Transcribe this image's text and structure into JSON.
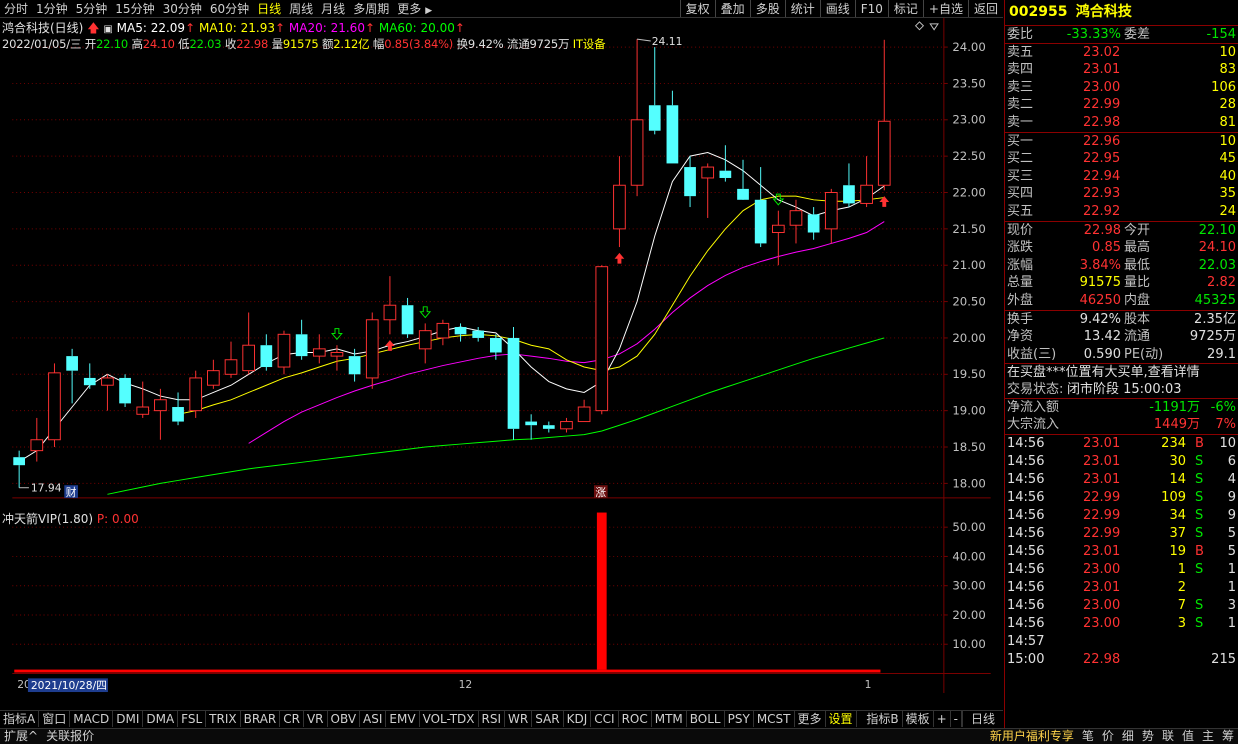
{
  "toolbar": {
    "periods": [
      "分时",
      "1分钟",
      "5分钟",
      "15分钟",
      "30分钟",
      "60分钟",
      "日线",
      "周线",
      "月线",
      "多周期",
      "更多"
    ],
    "active_period": "日线",
    "more_arrow": "▶",
    "right_buttons": [
      "复权",
      "叠加",
      "多股",
      "统计",
      "画线",
      "F10",
      "标记",
      "+自选",
      "返回"
    ]
  },
  "info": {
    "name_label": "鸿合科技(日线)",
    "ma5_label": "MA5: 22.09",
    "ma10_label": "MA10: 21.93",
    "ma20_label": "MA20: 21.60",
    "ma60_label": "MA60: 20.00",
    "date": "2022/01/05/三",
    "open_label": "开",
    "open": "22.10",
    "high_label": "高",
    "high": "24.10",
    "low_label": "低",
    "low": "22.03",
    "close_label": "收",
    "close": "22.98",
    "volume_label": "量",
    "volume": "91575",
    "amount_label": "额",
    "amount": "2.12亿",
    "change_label": "幅",
    "change": "0.85(3.84%)",
    "turnover_label": "换",
    "turnover": "9.42%",
    "float_label": "流通",
    "float": "9725万",
    "sector": "IT设备"
  },
  "colors": {
    "up": "#ff3232",
    "down": "#54ffff",
    "ma5": "#ffffff",
    "ma10": "#ffff00",
    "ma20": "#ff00ff",
    "ma60": "#00ff00",
    "grid": "#7a0000",
    "axis_text": "#c0c0c0"
  },
  "chart_data": {
    "type": "candlestick",
    "y_axis_labels": [
      "24.00",
      "23.50",
      "23.00",
      "22.50",
      "22.00",
      "21.50",
      "21.00",
      "20.50",
      "20.00",
      "19.50",
      "19.00",
      "18.50",
      "18.00"
    ],
    "ylim": [
      17.8,
      24.4
    ],
    "max_annotation": "24.11",
    "min_annotation": "17.94",
    "candles": [
      {
        "o": 18.36,
        "h": 18.45,
        "l": 17.94,
        "c": 18.25
      },
      {
        "o": 18.45,
        "h": 18.9,
        "l": 18.3,
        "c": 18.6
      },
      {
        "o": 18.6,
        "h": 19.65,
        "l": 18.5,
        "c": 19.52
      },
      {
        "o": 19.75,
        "h": 19.85,
        "l": 19.1,
        "c": 19.55
      },
      {
        "o": 19.45,
        "h": 19.65,
        "l": 19.3,
        "c": 19.35
      },
      {
        "o": 19.35,
        "h": 19.5,
        "l": 19.0,
        "c": 19.45
      },
      {
        "o": 19.45,
        "h": 19.5,
        "l": 19.05,
        "c": 19.1
      },
      {
        "o": 18.95,
        "h": 19.4,
        "l": 18.9,
        "c": 19.05
      },
      {
        "o": 19.0,
        "h": 19.3,
        "l": 18.6,
        "c": 19.15
      },
      {
        "o": 19.05,
        "h": 19.25,
        "l": 18.8,
        "c": 18.85
      },
      {
        "o": 19.0,
        "h": 19.55,
        "l": 18.9,
        "c": 19.45
      },
      {
        "o": 19.35,
        "h": 19.7,
        "l": 19.3,
        "c": 19.55
      },
      {
        "o": 19.5,
        "h": 19.95,
        "l": 19.45,
        "c": 19.7
      },
      {
        "o": 19.55,
        "h": 20.35,
        "l": 19.5,
        "c": 19.9
      },
      {
        "o": 19.9,
        "h": 20.05,
        "l": 19.55,
        "c": 19.6
      },
      {
        "o": 19.6,
        "h": 20.1,
        "l": 19.5,
        "c": 20.05
      },
      {
        "o": 20.05,
        "h": 20.25,
        "l": 19.7,
        "c": 19.75
      },
      {
        "o": 19.75,
        "h": 20.05,
        "l": 19.65,
        "c": 19.85
      },
      {
        "o": 19.75,
        "h": 19.9,
        "l": 19.55,
        "c": 19.8
      },
      {
        "o": 19.75,
        "h": 19.85,
        "l": 19.4,
        "c": 19.5
      },
      {
        "o": 19.45,
        "h": 20.35,
        "l": 19.3,
        "c": 20.25
      },
      {
        "o": 20.25,
        "h": 20.85,
        "l": 20.05,
        "c": 20.45
      },
      {
        "o": 20.45,
        "h": 20.55,
        "l": 20.0,
        "c": 20.05
      },
      {
        "o": 19.85,
        "h": 20.2,
        "l": 19.65,
        "c": 20.1
      },
      {
        "o": 20.0,
        "h": 20.25,
        "l": 19.9,
        "c": 20.2
      },
      {
        "o": 20.15,
        "h": 20.2,
        "l": 19.95,
        "c": 20.05
      },
      {
        "o": 20.1,
        "h": 20.15,
        "l": 19.95,
        "c": 20.0
      },
      {
        "o": 20.0,
        "h": 20.05,
        "l": 19.7,
        "c": 19.8
      },
      {
        "o": 20.0,
        "h": 20.15,
        "l": 18.6,
        "c": 18.75
      },
      {
        "o": 18.85,
        "h": 18.95,
        "l": 18.6,
        "c": 18.8
      },
      {
        "o": 18.8,
        "h": 18.85,
        "l": 18.7,
        "c": 18.75
      },
      {
        "o": 18.75,
        "h": 18.9,
        "l": 18.7,
        "c": 18.85
      },
      {
        "o": 18.85,
        "h": 19.15,
        "l": 18.85,
        "c": 19.05
      },
      {
        "o": 19.0,
        "h": 21.0,
        "l": 18.95,
        "c": 20.98
      },
      {
        "o": 21.5,
        "h": 22.5,
        "l": 21.25,
        "c": 22.1
      },
      {
        "o": 22.1,
        "h": 24.11,
        "l": 21.95,
        "c": 23.0
      },
      {
        "o": 23.2,
        "h": 24.0,
        "l": 22.8,
        "c": 22.85
      },
      {
        "o": 23.2,
        "h": 23.4,
        "l": 22.4,
        "c": 22.4
      },
      {
        "o": 22.35,
        "h": 22.5,
        "l": 21.8,
        "c": 21.95
      },
      {
        "o": 22.2,
        "h": 22.4,
        "l": 21.65,
        "c": 22.35
      },
      {
        "o": 22.3,
        "h": 22.65,
        "l": 22.15,
        "c": 22.2
      },
      {
        "o": 22.05,
        "h": 22.45,
        "l": 21.95,
        "c": 21.9
      },
      {
        "o": 21.9,
        "h": 22.35,
        "l": 21.25,
        "c": 21.3
      },
      {
        "o": 21.45,
        "h": 21.75,
        "l": 21.0,
        "c": 21.55
      },
      {
        "o": 21.55,
        "h": 21.9,
        "l": 21.3,
        "c": 21.75
      },
      {
        "o": 21.7,
        "h": 21.8,
        "l": 21.35,
        "c": 21.45
      },
      {
        "o": 21.5,
        "h": 22.05,
        "l": 21.3,
        "c": 22.0
      },
      {
        "o": 22.1,
        "h": 22.4,
        "l": 21.8,
        "c": 21.85
      },
      {
        "o": 21.85,
        "h": 22.5,
        "l": 21.8,
        "c": 22.1
      },
      {
        "o": 22.1,
        "h": 24.1,
        "l": 22.03,
        "c": 22.98
      }
    ],
    "ma5": [
      18.3,
      18.45,
      18.75,
      19.05,
      19.35,
      19.5,
      19.38,
      19.3,
      19.2,
      19.15,
      19.15,
      19.25,
      19.35,
      19.5,
      19.65,
      19.77,
      19.8,
      19.8,
      19.85,
      19.78,
      19.82,
      19.9,
      19.95,
      20.02,
      20.1,
      20.15,
      20.1,
      20.07,
      19.85,
      19.6,
      19.4,
      19.3,
      19.25,
      19.4,
      19.85,
      20.5,
      21.4,
      22.15,
      22.5,
      22.55,
      22.45,
      22.3,
      22.1,
      21.9,
      21.8,
      21.68,
      21.75,
      21.8,
      21.92,
      22.09
    ],
    "ma10": [
      null,
      null,
      null,
      null,
      null,
      null,
      null,
      null,
      null,
      18.95,
      19.0,
      19.08,
      19.15,
      19.25,
      19.35,
      19.45,
      19.52,
      19.6,
      19.68,
      19.72,
      19.78,
      19.84,
      19.9,
      19.95,
      20.0,
      20.03,
      20.05,
      20.03,
      19.98,
      19.9,
      19.85,
      19.7,
      19.6,
      19.55,
      19.6,
      19.75,
      20.05,
      20.45,
      20.85,
      21.2,
      21.5,
      21.75,
      21.9,
      21.95,
      21.95,
      21.9,
      21.88,
      21.88,
      21.9,
      21.93
    ],
    "ma20": [
      null,
      null,
      null,
      null,
      null,
      null,
      null,
      null,
      null,
      null,
      null,
      null,
      null,
      18.55,
      18.7,
      18.85,
      18.98,
      19.08,
      19.18,
      19.27,
      19.35,
      19.42,
      19.5,
      19.56,
      19.62,
      19.67,
      19.72,
      19.76,
      19.78,
      19.75,
      19.72,
      19.68,
      19.66,
      19.7,
      19.78,
      19.92,
      20.12,
      20.35,
      20.55,
      20.72,
      20.86,
      20.97,
      21.05,
      21.12,
      21.18,
      21.23,
      21.3,
      21.37,
      21.45,
      21.6
    ],
    "ma60": [
      null,
      null,
      null,
      null,
      null,
      17.85,
      17.9,
      17.95,
      18.0,
      18.04,
      18.08,
      18.12,
      18.16,
      18.2,
      18.23,
      18.26,
      18.29,
      18.32,
      18.35,
      18.38,
      18.41,
      18.44,
      18.47,
      18.5,
      18.52,
      18.54,
      18.56,
      18.58,
      18.6,
      18.61,
      18.63,
      18.65,
      18.67,
      18.72,
      18.8,
      18.88,
      18.97,
      19.06,
      19.15,
      19.24,
      19.32,
      19.4,
      19.48,
      19.56,
      19.64,
      19.72,
      19.79,
      19.86,
      19.93,
      20.0
    ],
    "arrows_up_at": [
      21,
      34,
      49
    ],
    "arrows_down_at": [
      18,
      23,
      43
    ],
    "markers": [
      {
        "at": 3,
        "text": "财"
      },
      {
        "at": 33,
        "text": "涨"
      }
    ],
    "indicator": {
      "name": "冲天箭VIP(1.80)",
      "p_label": "P: 0.00",
      "y_axis_labels": [
        "50.00",
        "40.00",
        "30.00",
        "20.00",
        "10.00"
      ],
      "ylim": [
        0,
        58
      ],
      "spike_at": 33,
      "spike_value": 55
    },
    "x_labels": [
      {
        "at": 0,
        "text": "20"
      },
      {
        "at": 25,
        "text": "12"
      },
      {
        "at": 48,
        "text": "1"
      }
    ],
    "cursor_date": "2021/10/28/四"
  },
  "indicator_tabs": [
    "指标A",
    "窗口",
    "MACD",
    "DMI",
    "DMA",
    "FSL",
    "TRIX",
    "BRAR",
    "CR",
    "VR",
    "OBV",
    "ASI",
    "EMV",
    "VOL-TDX",
    "RSI",
    "WR",
    "SAR",
    "KDJ",
    "CCI",
    "ROC",
    "MTM",
    "BOLL",
    "PSY",
    "MCST",
    "更多",
    "设置"
  ],
  "indicator_tabs_right": [
    "指标B",
    "模板",
    "+",
    "-"
  ],
  "period_label": "日线",
  "bottom_status": [
    "扩展^",
    "关联报价"
  ],
  "bottom_status_right": [
    "新用户福利专享",
    "笔",
    "价",
    "细",
    "势",
    "联",
    "值",
    "主",
    "筹"
  ],
  "quote": {
    "code": "002955",
    "name": "鸿合科技",
    "wb_label": "委比",
    "wb": "-33.33%",
    "wc_label": "委差",
    "wc": "-154",
    "asks": [
      {
        "label": "卖五",
        "price": "23.02",
        "vol": "10"
      },
      {
        "label": "卖四",
        "price": "23.01",
        "vol": "83"
      },
      {
        "label": "卖三",
        "price": "23.00",
        "vol": "106"
      },
      {
        "label": "卖二",
        "price": "22.99",
        "vol": "28"
      },
      {
        "label": "卖一",
        "price": "22.98",
        "vol": "81"
      }
    ],
    "bids": [
      {
        "label": "买一",
        "price": "22.96",
        "vol": "10"
      },
      {
        "label": "买二",
        "price": "22.95",
        "vol": "45"
      },
      {
        "label": "买三",
        "price": "22.94",
        "vol": "40"
      },
      {
        "label": "买四",
        "price": "22.93",
        "vol": "35"
      },
      {
        "label": "买五",
        "price": "22.92",
        "vol": "24"
      }
    ],
    "stats": [
      {
        "l1": "现价",
        "v1": "22.98",
        "c1": "red",
        "l2": "今开",
        "v2": "22.10",
        "c2": "green"
      },
      {
        "l1": "涨跌",
        "v1": "0.85",
        "c1": "red",
        "l2": "最高",
        "v2": "24.10",
        "c2": "red"
      },
      {
        "l1": "涨幅",
        "v1": "3.84%",
        "c1": "red",
        "l2": "最低",
        "v2": "22.03",
        "c2": "green"
      },
      {
        "l1": "总量",
        "v1": "91575",
        "c1": "yellow",
        "l2": "量比",
        "v2": "2.82",
        "c2": "red"
      },
      {
        "l1": "外盘",
        "v1": "46250",
        "c1": "red",
        "l2": "内盘",
        "v2": "45325",
        "c2": "green"
      }
    ],
    "stats2": [
      {
        "l1": "换手",
        "v1": "9.42%",
        "c1": "white",
        "l2": "股本",
        "v2": "2.35亿",
        "c2": "white"
      },
      {
        "l1": "净资",
        "v1": "13.42",
        "c1": "white",
        "l2": "流通",
        "v2": "9725万",
        "c2": "white"
      },
      {
        "l1": "收益(三)",
        "v1": "0.590",
        "c1": "white",
        "l2": "PE(动)",
        "v2": "29.1",
        "c2": "white"
      }
    ],
    "notice": "在买盘***位置有大买单,查看详情",
    "trade_status_label": "交易状态:",
    "trade_status": "闭市阶段 15:00:03",
    "netflow_label": "净流入额",
    "netflow": "-1191万",
    "netflow_pct": "-6%",
    "block_label": "大宗流入",
    "block": "1449万",
    "block_pct": "7%",
    "ticks": [
      {
        "time": "14:56",
        "price": "23.01",
        "vol": "234",
        "bs": "B",
        "n": "10"
      },
      {
        "time": "14:56",
        "price": "23.01",
        "vol": "30",
        "bs": "S",
        "n": "6"
      },
      {
        "time": "14:56",
        "price": "23.01",
        "vol": "14",
        "bs": "S",
        "n": "4"
      },
      {
        "time": "14:56",
        "price": "22.99",
        "vol": "109",
        "bs": "S",
        "n": "9"
      },
      {
        "time": "14:56",
        "price": "22.99",
        "vol": "34",
        "bs": "S",
        "n": "9"
      },
      {
        "time": "14:56",
        "price": "22.99",
        "vol": "37",
        "bs": "S",
        "n": "5"
      },
      {
        "time": "14:56",
        "price": "23.01",
        "vol": "19",
        "bs": "B",
        "n": "5"
      },
      {
        "time": "14:56",
        "price": "23.00",
        "vol": "1",
        "bs": "S",
        "n": "1"
      },
      {
        "time": "14:56",
        "price": "23.01",
        "vol": "2",
        "bs": "",
        "n": "1"
      },
      {
        "time": "14:56",
        "price": "23.00",
        "vol": "7",
        "bs": "S",
        "n": "3"
      },
      {
        "time": "14:56",
        "price": "23.00",
        "vol": "3",
        "bs": "S",
        "n": "1"
      },
      {
        "time": "14:57",
        "price": "",
        "vol": "",
        "bs": "",
        "n": ""
      },
      {
        "time": "15:00",
        "price": "22.98",
        "vol": "",
        "bs": "",
        "n": "215"
      }
    ]
  }
}
